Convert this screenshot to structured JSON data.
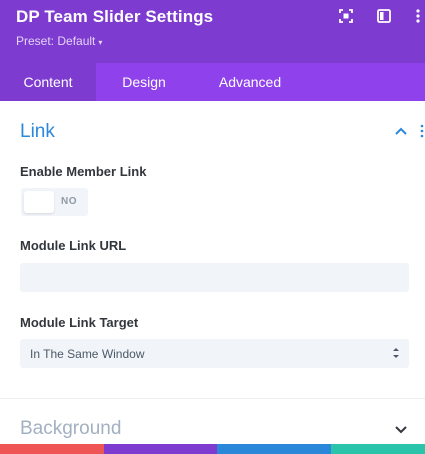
{
  "header": {
    "title": "DP Team Slider Settings",
    "preset": "Preset: Default",
    "icons": [
      "expand-icon",
      "sidebar-icon",
      "more-vertical-icon"
    ]
  },
  "tabs": [
    {
      "label": "Content",
      "active": true
    },
    {
      "label": "Design",
      "active": false
    },
    {
      "label": "Advanced",
      "active": false
    }
  ],
  "link_section": {
    "title": "Link",
    "expanded": true,
    "enable_member_link": {
      "label": "Enable Member Link",
      "value": "NO"
    },
    "module_link_url": {
      "label": "Module Link URL",
      "value": ""
    },
    "module_link_target": {
      "label": "Module Link Target",
      "value": "In The Same Window"
    }
  },
  "background_section": {
    "title": "Background",
    "expanded": false
  },
  "colors": {
    "header": "#7e3bd0",
    "tabs": "#8f42ec",
    "section_title_active": "#2b87da",
    "section_title_collapsed": "#a3b0c2",
    "bottom_bar": [
      "#ef5555",
      "#7e3bd0",
      "#2b87da",
      "#29c4a9"
    ]
  }
}
